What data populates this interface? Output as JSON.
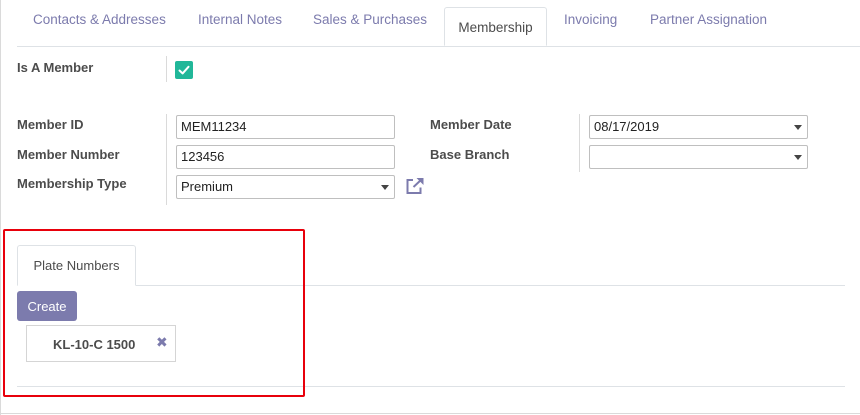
{
  "tabs": [
    {
      "label": "Contacts & Addresses"
    },
    {
      "label": "Internal Notes"
    },
    {
      "label": "Sales & Purchases"
    },
    {
      "label": "Membership"
    },
    {
      "label": "Invoicing"
    },
    {
      "label": "Partner Assignation"
    }
  ],
  "active_tab": "Membership",
  "form": {
    "is_member": {
      "label": "Is A Member",
      "checked": true
    },
    "member_id": {
      "label": "Member ID",
      "value": "MEM11234"
    },
    "member_number": {
      "label": "Member Number",
      "value": "123456"
    },
    "membership_type": {
      "label": "Membership Type",
      "value": "Premium"
    },
    "member_date": {
      "label": "Member Date",
      "value": "08/17/2019"
    },
    "base_branch": {
      "label": "Base Branch",
      "value": ""
    }
  },
  "plates": {
    "tab_label": "Plate Numbers",
    "create_label": "Create",
    "items": [
      {
        "plate": "KL-10-C 1500",
        "remove_glyph": "✖"
      }
    ]
  },
  "icons": {
    "checkbox": "checkmark-icon",
    "external_link": "external-link-icon",
    "dropdown": "caret-down-icon",
    "remove": "close-icon"
  },
  "colors": {
    "accent": "#7c7bad",
    "checkbox": "#21b799",
    "highlight": "#e8000b"
  }
}
